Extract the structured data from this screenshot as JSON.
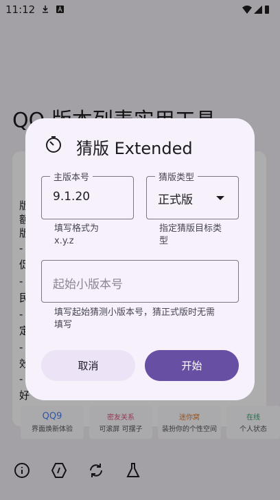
{
  "status_bar": {
    "time": "11:12"
  },
  "background": {
    "title": "QQ 版本列表实用工具",
    "list_fragments": [
      "版",
      "额",
      "版",
      "-",
      "促",
      "-",
      "民",
      "-",
      "定",
      "-",
      "效",
      "-",
      "好"
    ],
    "thumbnails": [
      {
        "title": "QQ9",
        "subtitle": "界面焕新体验"
      },
      {
        "title": "密友关系",
        "subtitle": "可滚屏 可摆子"
      },
      {
        "title": "迷你窝",
        "subtitle": "装扮你的个性空间"
      },
      {
        "title": "在线",
        "subtitle": "个人状态"
      }
    ],
    "bottom_nav_icons": [
      "info-icon",
      "hexagon-code-icon",
      "refresh-icon",
      "flask-icon"
    ]
  },
  "dialog": {
    "title": "猜版 Extended",
    "icon": "timer-icon",
    "main_version": {
      "label": "主版本号",
      "value": "9.1.20",
      "support": "填写格式为\nx.y.z"
    },
    "guess_type": {
      "label": "猜版类型",
      "value": "正式版",
      "support": "指定猜版目标类\n型"
    },
    "start_minor": {
      "placeholder": "起始小版本号",
      "support": "填写起始猜测小版本号，猜正式版时无需\n填写"
    },
    "cancel_label": "取消",
    "start_label": "开始"
  },
  "colors": {
    "primary": "#6750a4",
    "dialog_surface": "#f6f1fb",
    "cancel_container": "#ece3f7"
  }
}
